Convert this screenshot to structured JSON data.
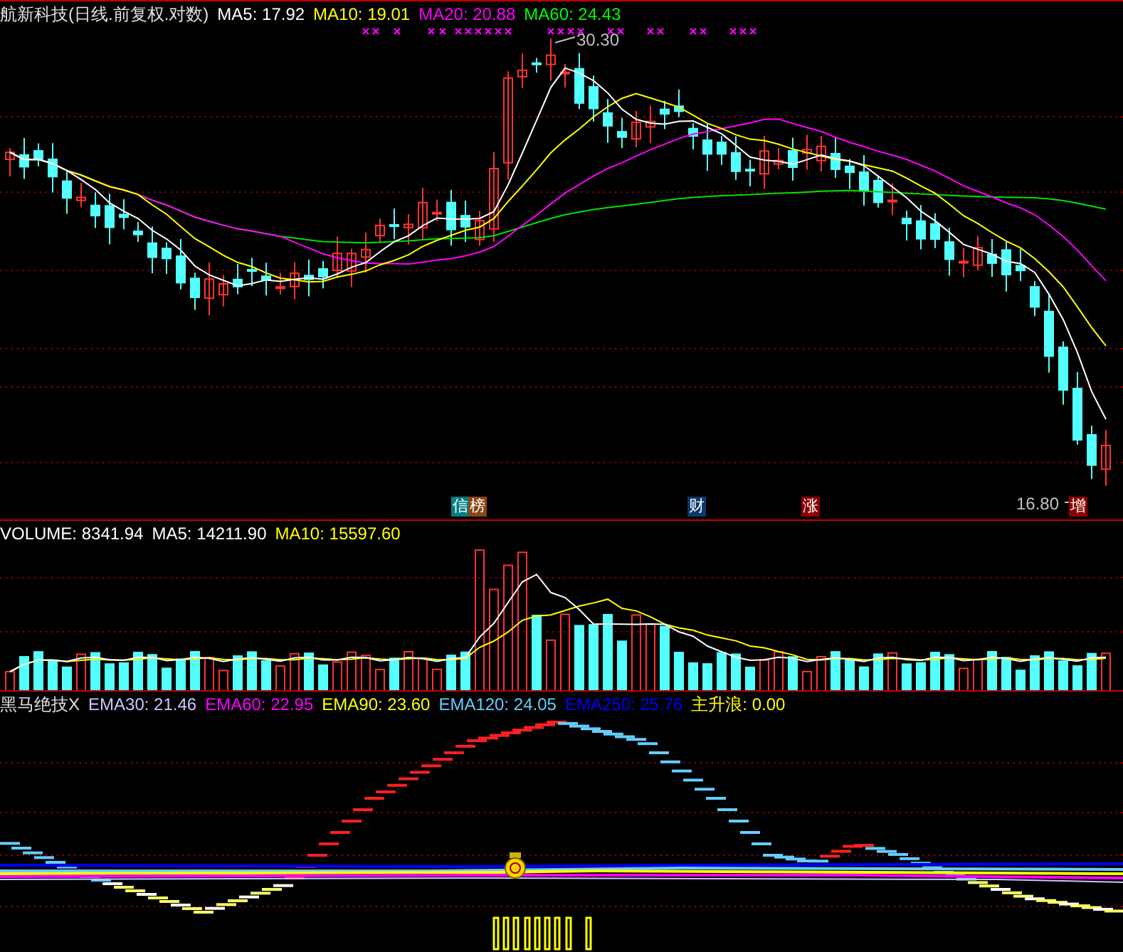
{
  "main_panel": {
    "title": "航新科技(日线.前复权.对数)",
    "legend": [
      {
        "label": "MA5: 17.92",
        "color": "#ffffff"
      },
      {
        "label": "MA10: 19.01",
        "color": "#ffff00"
      },
      {
        "label": "MA20: 20.88",
        "color": "#ff00ff"
      },
      {
        "label": "MA60: 24.43",
        "color": "#00ff00"
      }
    ],
    "high_label": "30.30",
    "low_label": "16.80",
    "badges": [
      {
        "text": "信",
        "color": "#008080"
      },
      {
        "text": "榜",
        "color": "#8b4513"
      },
      {
        "text": "财",
        "color": "#0a3a6a"
      },
      {
        "text": "涨",
        "color": "#8b0000"
      },
      {
        "text": "增",
        "color": "#8b0000"
      }
    ]
  },
  "volume_panel": {
    "legend": [
      {
        "label": "VOLUME: 8341.94",
        "color": "#ffffff"
      },
      {
        "label": "MA5: 14211.90",
        "color": "#ffffff"
      },
      {
        "label": "MA10: 15597.60",
        "color": "#ffff00"
      }
    ]
  },
  "indicator_panel": {
    "title": "黑马绝技X",
    "legend": [
      {
        "label": "EMA30: 21.46",
        "color": "#c8c8ff"
      },
      {
        "label": "EMA60: 22.95",
        "color": "#ff00ff"
      },
      {
        "label": "EMA90: 23.60",
        "color": "#ffff00"
      },
      {
        "label": "EMA120: 24.05",
        "color": "#66ccff"
      },
      {
        "label": "EMA250: 25.76",
        "color": "#0000ff"
      },
      {
        "label": "主升浪: 0.00",
        "color": "#ffff00"
      }
    ]
  }
}
